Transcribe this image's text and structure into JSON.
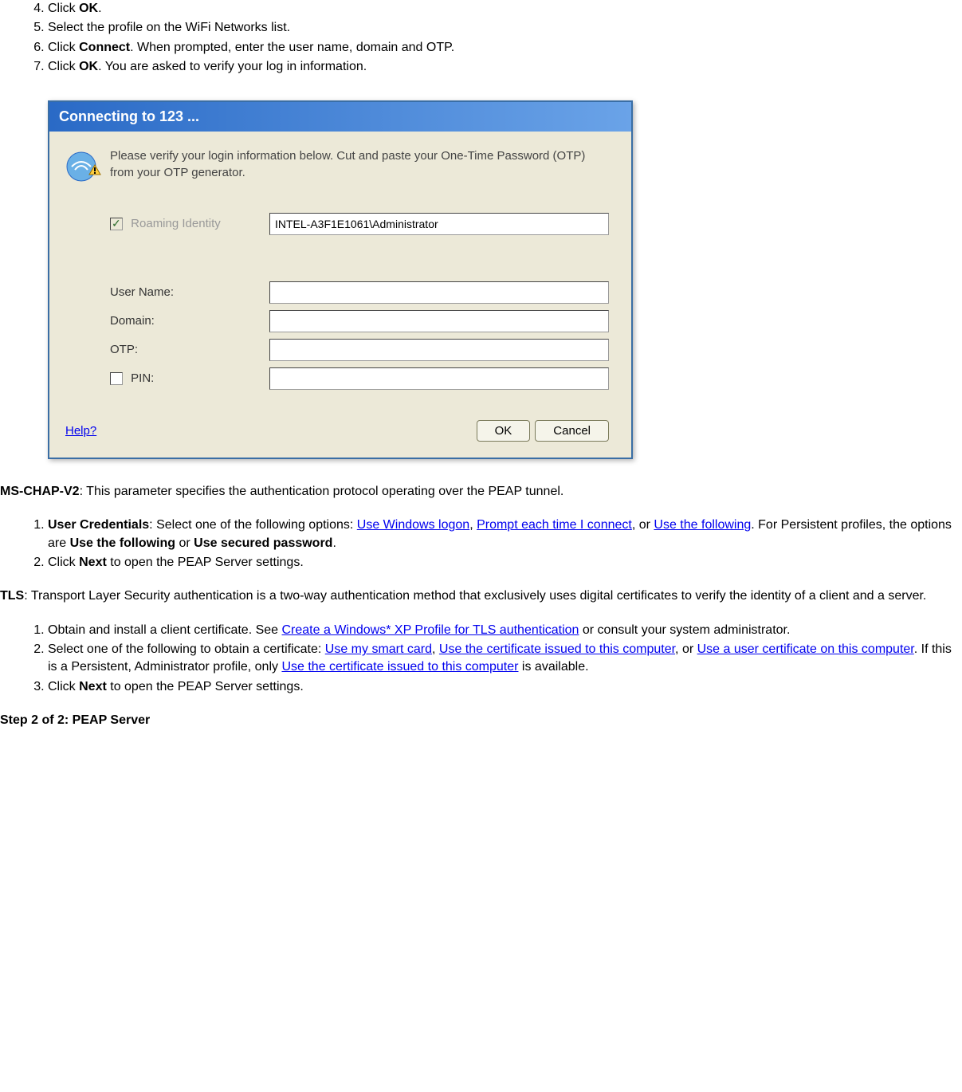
{
  "top_list": [
    {
      "prefix": "Click ",
      "bold": "OK",
      "suffix": "."
    },
    {
      "prefix": "Select the profile on the WiFi Networks list.",
      "bold": "",
      "suffix": ""
    },
    {
      "prefix": "Click ",
      "bold": "Connect",
      "suffix": ". When prompted, enter the user name, domain and OTP."
    },
    {
      "prefix": "Click ",
      "bold": "OK",
      "suffix": ". You are asked to verify your log in information."
    }
  ],
  "top_list_start": 4,
  "dialog": {
    "title": "Connecting to 123 ...",
    "message": "Please verify your login information below. Cut and paste your One-Time Password (OTP) from your OTP generator.",
    "roaming_label": "Roaming Identity",
    "roaming_value": "INTEL-A3F1E1061\\Administrator",
    "username_label": "User Name:",
    "domain_label": "Domain:",
    "otp_label": "OTP:",
    "pin_label": "PIN:",
    "help_label": "Help?",
    "ok_label": "OK",
    "cancel_label": "Cancel"
  },
  "mschap": {
    "title": "MS-CHAP-V2",
    "desc": ": This parameter specifies the authentication protocol operating over the PEAP tunnel."
  },
  "mschap_list": [
    {
      "bold1": "User Credentials",
      "t1": ": Select one of the following options: ",
      "link1": "Use Windows logon",
      "t2": ", ",
      "link2": "Prompt each time I connect",
      "t3": ", or ",
      "link3": "Use the following",
      "t4": ". For Persistent profiles, the options are ",
      "bold2": "Use the following",
      "t5": " or ",
      "bold3": "Use secured password",
      "t6": "."
    },
    {
      "t1": "Click ",
      "bold1": "Next",
      "t2": " to open the PEAP Server settings."
    }
  ],
  "tls": {
    "title": "TLS",
    "desc": ": Transport Layer Security authentication is a two-way authentication method that exclusively uses digital certificates to verify the identity of a client and a server."
  },
  "tls_list": [
    {
      "t1": "Obtain and install a client certificate. See ",
      "link1": "Create a Windows* XP Profile for TLS authentication",
      "t2": " or consult your system administrator."
    },
    {
      "t1": "Select one of the following to obtain a certificate: ",
      "link1": "Use my smart card",
      "t2": ", ",
      "link2": "Use the certificate issued to this computer",
      "t3": ", or ",
      "link3": "Use a user certificate on this computer",
      "t4": ". If this is a Persistent, Administrator profile, only ",
      "link4": "Use the certificate issued to this computer",
      "t5": " is available."
    },
    {
      "t1": "Click ",
      "bold1": "Next",
      "t2": " to open the PEAP Server settings."
    }
  ],
  "step_heading": "Step 2 of 2: PEAP Server"
}
